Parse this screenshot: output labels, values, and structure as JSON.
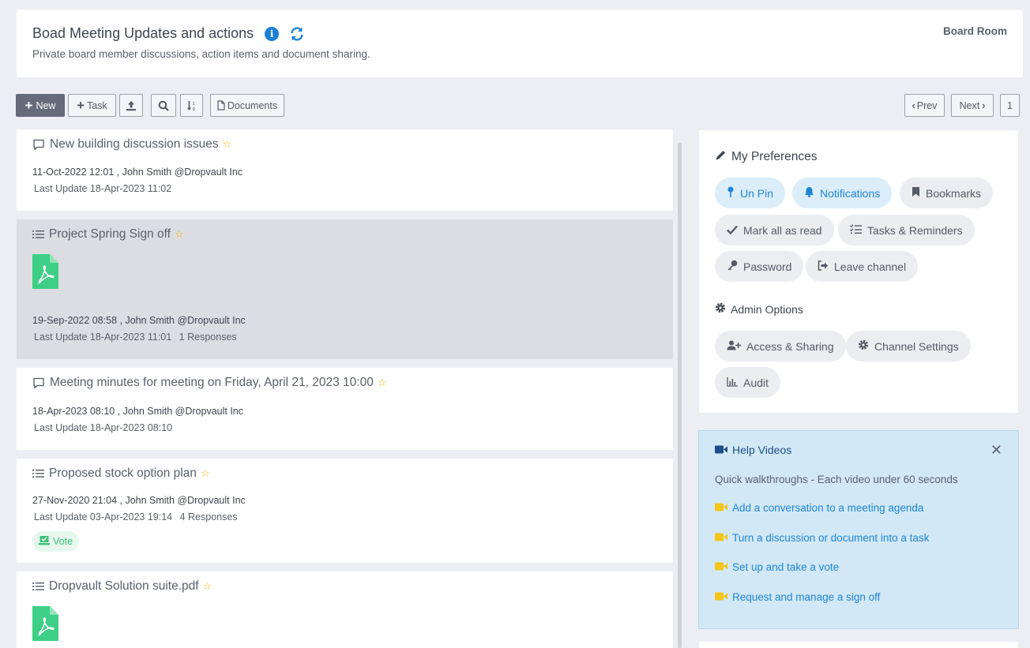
{
  "header": {
    "title": "Boad Meeting Updates and actions",
    "subtitle": "Private board member discussions, action items and document sharing.",
    "room": "Board Room"
  },
  "toolbar": {
    "new_label": "New",
    "task_label": "Task",
    "documents_label": "Documents",
    "prev_label": "Prev",
    "next_label": "Next",
    "page": "1"
  },
  "items": [
    {
      "title": "New building discussion issues",
      "created": "11-Oct-2022 12:01 , John Smith @Dropvault Inc",
      "updated": "Last Update 18-Apr-2023 11:02"
    },
    {
      "title": "Project Spring Sign off",
      "created": "19-Sep-2022 08:58 , John Smith @Dropvault Inc",
      "updated": "Last Update 18-Apr-2023 11:01",
      "responses": "1 Responses"
    },
    {
      "title": "Meeting minutes for meeting on Friday, April 21, 2023 10:00",
      "created": "18-Apr-2023 08:10 , John Smith @Dropvault Inc",
      "updated": "Last Update 18-Apr-2023 08:10"
    },
    {
      "title": "Proposed stock option plan",
      "created": "27-Nov-2020 21:04 , John Smith @Dropvault Inc",
      "updated": "Last Update 03-Apr-2023 19:14",
      "responses": "4 Responses",
      "badge": "Vote"
    },
    {
      "title": "Dropvault Solution suite.pdf"
    }
  ],
  "preferences": {
    "title": "My Preferences",
    "buttons": [
      "Un Pin",
      "Notifications",
      "Bookmarks",
      "Mark all as read",
      "Tasks & Reminders",
      "Password",
      "Leave channel"
    ],
    "admin_title": "Admin Options",
    "admin_buttons": [
      "Access & Sharing",
      "Channel Settings",
      "Audit"
    ]
  },
  "help": {
    "title": "Help Videos",
    "subtitle": "Quick walkthroughs - Each video under 60 seconds",
    "links": [
      "Add a conversation to a meeting agenda",
      "Turn a discussion or document into a task",
      "Set up and take a vote",
      "Request and manage a sign off"
    ]
  },
  "colors": {
    "accent": "#1e85d6",
    "pdf_green": "#3ecf86",
    "star": "#f0b400",
    "video_yellow": "#f5c518"
  }
}
